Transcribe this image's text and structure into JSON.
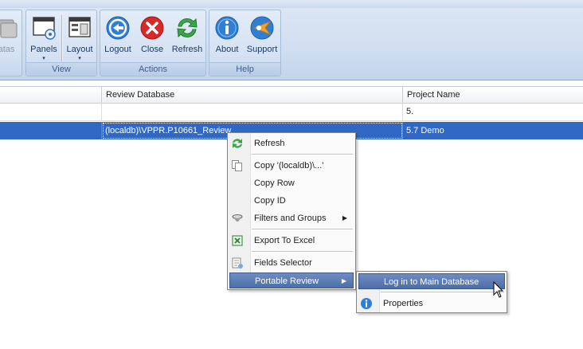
{
  "ribbon": {
    "cut_left_label": "atas",
    "groups": [
      {
        "label": "View",
        "buttons": [
          {
            "label": "Panels",
            "icon": "panels-icon"
          },
          {
            "label": "Layout",
            "icon": "layout-icon"
          }
        ]
      },
      {
        "label": "Actions",
        "buttons": [
          {
            "label": "Logout",
            "icon": "logout-icon"
          },
          {
            "label": "Close",
            "icon": "close-icon"
          },
          {
            "label": "Refresh",
            "icon": "refresh-icon"
          }
        ]
      },
      {
        "label": "Help",
        "buttons": [
          {
            "label": "About",
            "icon": "info-icon"
          },
          {
            "label": "Support",
            "icon": "support-icon"
          }
        ]
      }
    ],
    "dropdown_arrow": "▾"
  },
  "grid": {
    "columns": [
      "",
      "Review Database",
      "Project Name"
    ],
    "rows": [
      [
        "",
        "",
        "5."
      ],
      [
        "",
        "(localdb)\\VPPR.P10661_Review",
        "5.7 Demo"
      ]
    ]
  },
  "context_menu": {
    "items": [
      {
        "label": "Refresh",
        "icon": "refresh-icon"
      },
      {
        "label": "Copy '(localdb)\\...'",
        "icon": "copy-icon"
      },
      {
        "label": "Copy Row",
        "icon": ""
      },
      {
        "label": "Copy ID",
        "icon": ""
      },
      {
        "label": "Filters and Groups",
        "icon": "filter-icon",
        "submenu": true
      },
      {
        "label": "Export To Excel",
        "icon": "excel-icon"
      },
      {
        "label": "Fields Selector",
        "icon": "fields-icon"
      },
      {
        "label": "Portable Review",
        "icon": "",
        "submenu": true
      }
    ],
    "submenu_arrow": "▶"
  },
  "submenu": {
    "items": [
      {
        "label": "Log in to Main Database",
        "icon": ""
      },
      {
        "label": "Properties",
        "icon": "info-icon"
      }
    ]
  },
  "colors": {
    "selection": "#3168c6",
    "menu_highlight": "#4d6ea8"
  }
}
